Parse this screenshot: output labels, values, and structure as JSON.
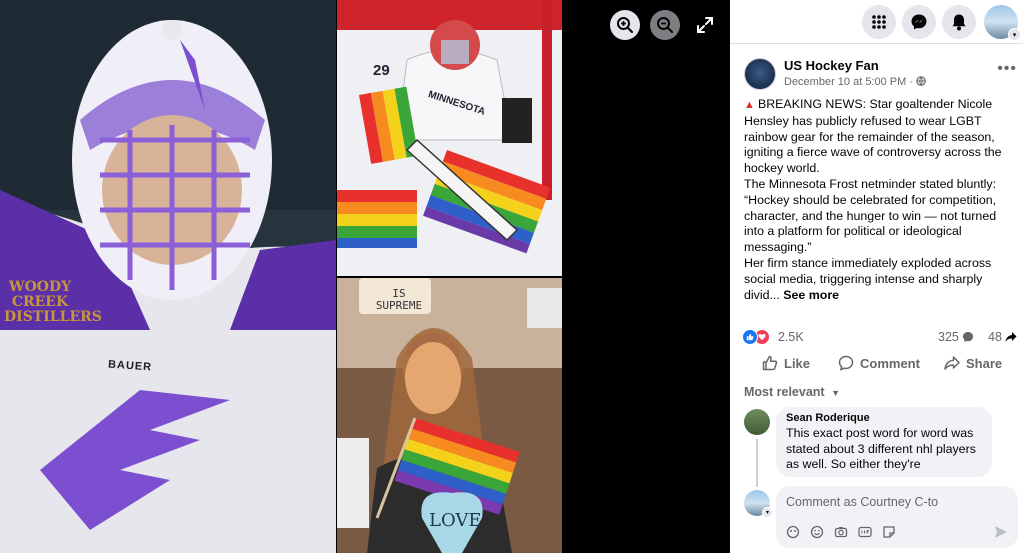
{
  "viewer": {
    "zoom_in_icon": "zoom-in-icon",
    "zoom_out_icon": "zoom-out-icon",
    "expand_icon": "expand-icon",
    "photo1_text": "WOODY CREEK DISTILLERS",
    "photo1_brand": "BAUER",
    "photo2_number": "29",
    "photo2_text": "MINNESOTA",
    "photo3_sign1": "IS SUPREME",
    "photo3_sign2": "LOVE"
  },
  "topbar": {
    "menu_icon": "menu-grid-icon",
    "messenger_icon": "messenger-icon",
    "notifications_icon": "bell-icon"
  },
  "post": {
    "page_name": "US Hockey Fan",
    "time": "December 10 at 5:00 PM",
    "privacy_icon": "globe-icon",
    "more_icon": "more-dots-icon",
    "paragraphs": [
      "BREAKING NEWS: Star goaltender Nicole Hensley has publicly refused to wear LGBT rainbow gear for the remainder of the season, igniting a fierce wave of controversy across the hockey world.",
      "The Minnesota Frost netminder stated bluntly: “Hockey should be celebrated for competition, character, and the hunger to win — not turned into a platform for political or ideological messaging.”",
      "Her firm stance immediately exploded across social media, triggering intense and sharply divid..."
    ],
    "see_more": "See more",
    "reaction_count": "2.5K",
    "comment_count": "325",
    "share_count": "48"
  },
  "actions": {
    "like": "Like",
    "comment": "Comment",
    "share": "Share"
  },
  "comments": {
    "sort_label": "Most relevant",
    "items": [
      {
        "name": "Sean Roderique",
        "text": "This exact post word for word was stated about 3 different nhl players as well. So either they're"
      }
    ]
  },
  "composer": {
    "placeholder": "Comment as Courtney C-to"
  },
  "colors": {
    "accent": "#1877f2",
    "love": "#f33e58",
    "panel_bg": "#ffffff",
    "bubble_bg": "#f0f2f5",
    "muted_text": "#65676b"
  }
}
